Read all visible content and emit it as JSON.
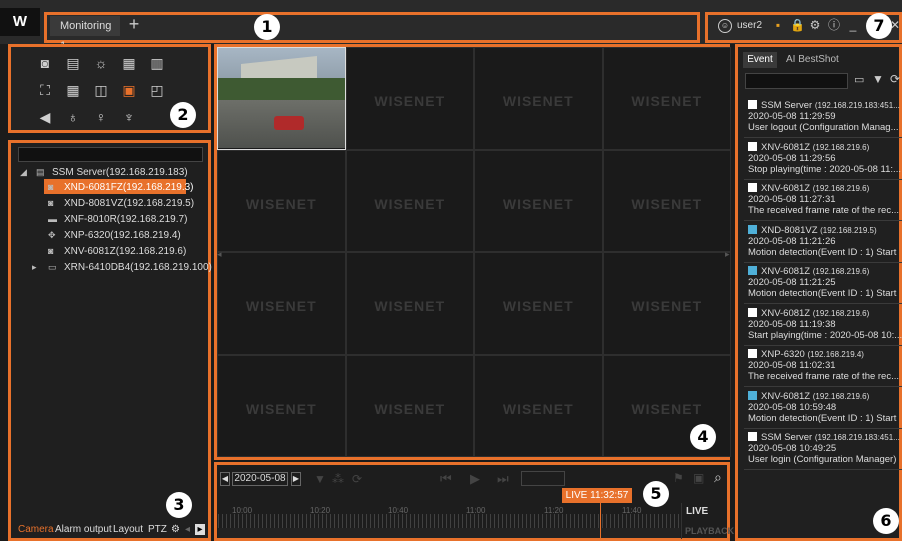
{
  "titlebar": {
    "logo": "W",
    "tab_label": "Monitoring 1",
    "add_tab": "+",
    "user": "user2"
  },
  "tree": {
    "server": "SSM Server(192.168.219.183)",
    "devices": [
      "XND-6081FZ(192.168.219.3)",
      "XND-8081VZ(192.168.219.5)",
      "XNF-8010R(192.168.219.7)",
      "XNP-6320(192.168.219.4)",
      "XNV-6081Z(192.168.219.6)",
      "XRN-6410DB4(192.168.219.100)"
    ]
  },
  "bottom_tabs": [
    "Camera",
    "Alarm output",
    "Layout",
    "PTZ"
  ],
  "grid": {
    "watermark": "WISENET"
  },
  "timeline": {
    "date": "2020-05-08",
    "live_time": "LIVE 11:32:57",
    "ticks": [
      "10:00",
      "10:20",
      "10:40",
      "11:00",
      "11:20",
      "11:40"
    ],
    "live_label": "LIVE",
    "playback_label": "PLAYBACK"
  },
  "events": {
    "tabs": [
      "Event",
      "AI BestShot"
    ],
    "items": [
      {
        "device": "SSM Server",
        "ip": "(192.168.219.183:451...",
        "time": "2020-05-08 11:29:59",
        "msg": "User logout (Configuration Manag...",
        "color": "#ffffff"
      },
      {
        "device": "XNV-6081Z",
        "ip": "(192.168.219.6)",
        "time": "2020-05-08 11:29:56",
        "msg": "Stop playing(time : 2020-05-08 11:...",
        "color": "#ffffff"
      },
      {
        "device": "XNV-6081Z",
        "ip": "(192.168.219.6)",
        "time": "2020-05-08 11:27:31",
        "msg": "The received frame rate of the rec...",
        "color": "#ffffff"
      },
      {
        "device": "XND-8081VZ",
        "ip": "(192.168.219.5)",
        "time": "2020-05-08 11:21:26",
        "msg": "Motion detection(Event ID : 1) Start",
        "color": "#4fb0d8"
      },
      {
        "device": "XNV-6081Z",
        "ip": "(192.168.219.6)",
        "time": "2020-05-08 11:21:25",
        "msg": "Motion detection(Event ID : 1) Start",
        "color": "#4fb0d8"
      },
      {
        "device": "XNV-6081Z",
        "ip": "(192.168.219.6)",
        "time": "2020-05-08 11:19:38",
        "msg": "Start playing(time : 2020-05-08 10:...",
        "color": "#ffffff"
      },
      {
        "device": "XNP-6320",
        "ip": "(192.168.219.4)",
        "time": "2020-05-08 11:02:31",
        "msg": "The received frame rate of the rec...",
        "color": "#ffffff"
      },
      {
        "device": "XNV-6081Z",
        "ip": "(192.168.219.6)",
        "time": "2020-05-08 10:59:48",
        "msg": "Motion detection(Event ID : 1) Start",
        "color": "#4fb0d8"
      },
      {
        "device": "SSM Server",
        "ip": "(192.168.219.183:451...",
        "time": "2020-05-08 10:49:25",
        "msg": "User login (Configuration Manager)",
        "color": "#ffffff"
      }
    ]
  },
  "callouts": [
    "1",
    "2",
    "3",
    "4",
    "5",
    "6",
    "7"
  ],
  "colors": {
    "accent": "#e8712b",
    "motion": "#4fb0d8"
  }
}
